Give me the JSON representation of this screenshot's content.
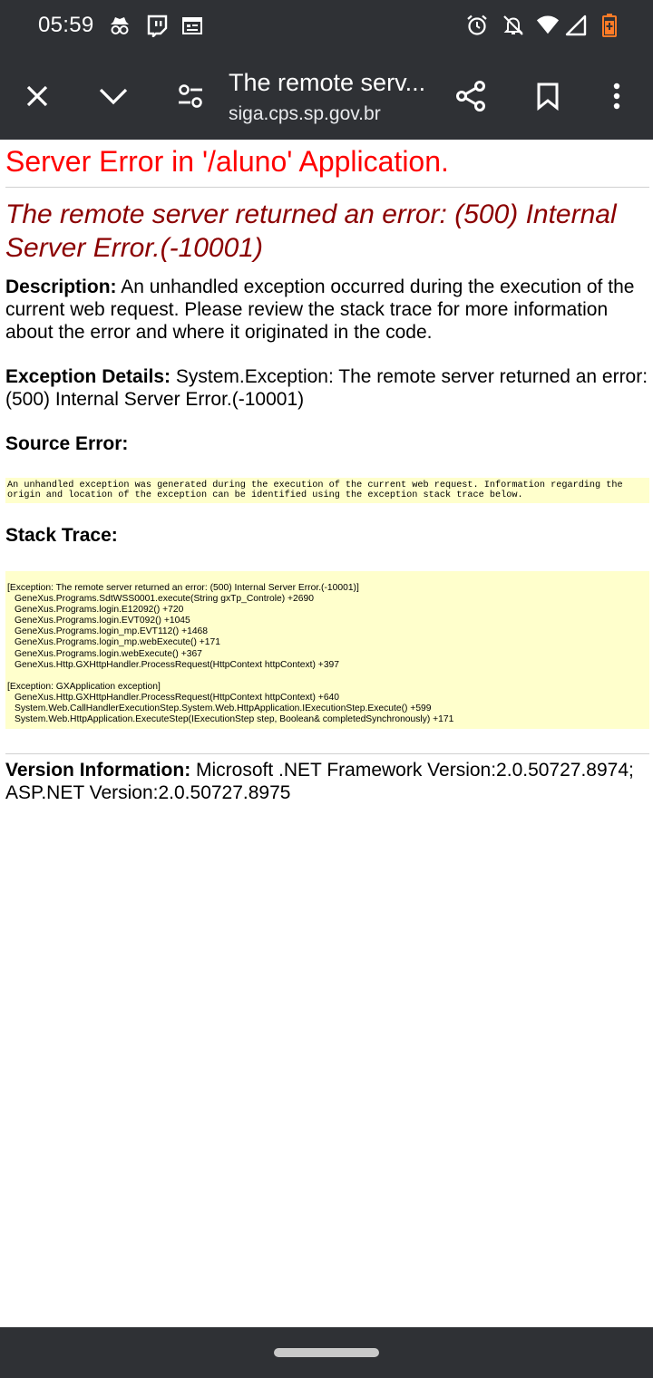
{
  "status_bar": {
    "time": "05:59",
    "left_icons": [
      "incognito-icon",
      "twitch-icon",
      "calendar-icon"
    ],
    "right_icons": [
      "alarm-icon",
      "bell-off-icon",
      "wifi-icon",
      "signal-icon",
      "battery-icon"
    ],
    "battery_color": "#ff7b27"
  },
  "toolbar": {
    "title": "The remote serv...",
    "url": "siga.cps.sp.gov.br",
    "icons": [
      "close-icon",
      "chevron-down-icon",
      "page-settings-icon",
      "share-icon",
      "bookmark-icon",
      "more-icon"
    ]
  },
  "page": {
    "heading": "Server Error in '/aluno' Application.",
    "error_title": "The remote server returned an error: (500) Internal Server Error.(-10001)",
    "description_label": "Description:",
    "description_text": " An unhandled exception occurred during the execution of the current web request. Please review the stack trace for more information about the error and where it originated in the code.",
    "exception_label": "Exception Details:",
    "exception_text": " System.Exception: The remote server returned an error: (500) Internal Server Error.(-10001)",
    "source_error_label": "Source Error:",
    "source_error_text": "An unhandled exception was generated during the execution of the current web request. Information regarding the origin and location of the exception can be identified using the exception stack trace below.",
    "stack_trace_label": "Stack Trace:",
    "stack_trace_block1": [
      "[Exception: The remote server returned an error: (500) Internal Server Error.(-10001)]",
      "GeneXus.Programs.SdtWSS0001.execute(String gxTp_Controle) +2690",
      "GeneXus.Programs.login.E12092() +720",
      "GeneXus.Programs.login.EVT092() +1045",
      "GeneXus.Programs.login_mp.EVT112() +1468",
      "GeneXus.Programs.login_mp.webExecute() +171",
      "GeneXus.Programs.login.webExecute() +367",
      "GeneXus.Http.GXHttpHandler.ProcessRequest(HttpContext httpContext) +397"
    ],
    "stack_trace_block2": [
      "[Exception: GXApplication exception]",
      "GeneXus.Http.GXHttpHandler.ProcessRequest(HttpContext httpContext) +640",
      "System.Web.CallHandlerExecutionStep.System.Web.HttpApplication.IExecutionStep.Execute() +599",
      "System.Web.HttpApplication.ExecuteStep(IExecutionStep step, Boolean& completedSynchronously) +171"
    ],
    "version_label": "Version Information:",
    "version_text": " Microsoft .NET Framework Version:2.0.50727.8974; ASP.NET Version:2.0.50727.8975"
  },
  "colors": {
    "chrome_background": "#2f3135",
    "heading_red": "#ff0000",
    "error_title_darkred": "#8b0000",
    "code_background": "#ffffcc"
  }
}
